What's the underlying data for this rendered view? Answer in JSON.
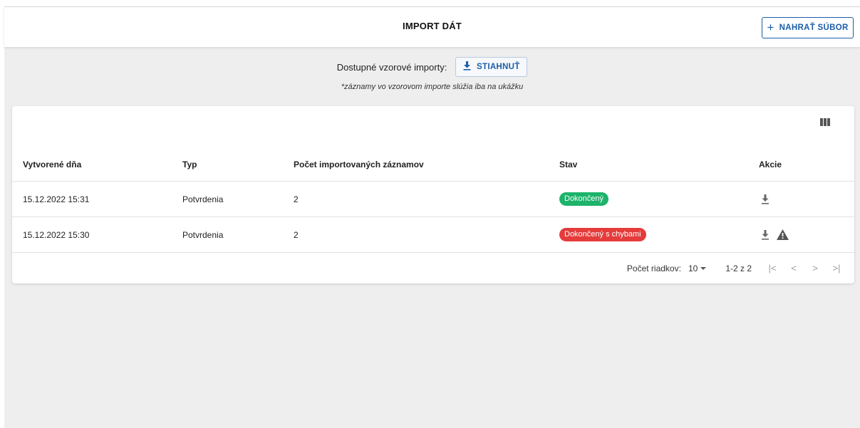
{
  "header": {
    "title": "IMPORT DÁT",
    "upload_label": "NAHRAŤ SÚBOR"
  },
  "samples": {
    "label": "Dostupné vzorové importy:",
    "download_label": "STIAHNUŤ",
    "note": "*záznamy vo vzorovom importe slúžia iba na ukážku"
  },
  "table": {
    "columns": [
      "Vytvorené dňa",
      "Typ",
      "Počet importovaných záznamov",
      "Stav",
      "Akcie"
    ],
    "rows": [
      {
        "created": "15.12.2022 15:31",
        "type": "Potvrdenia",
        "count": "2",
        "status": "Dokončený",
        "status_color": "#1db36a",
        "actions": [
          "download-icon"
        ]
      },
      {
        "created": "15.12.2022 15:30",
        "type": "Potvrdenia",
        "count": "2",
        "status": "Dokončený s chybami",
        "status_color": "#e53b3b",
        "actions": [
          "download-icon",
          "warning-icon"
        ]
      }
    ]
  },
  "pagination": {
    "rows_label": "Počet riadkov:",
    "rows_value": "10",
    "range": "1-2 z 2"
  },
  "colors": {
    "accent": "#1c5da8",
    "background": "#eeeeee"
  }
}
